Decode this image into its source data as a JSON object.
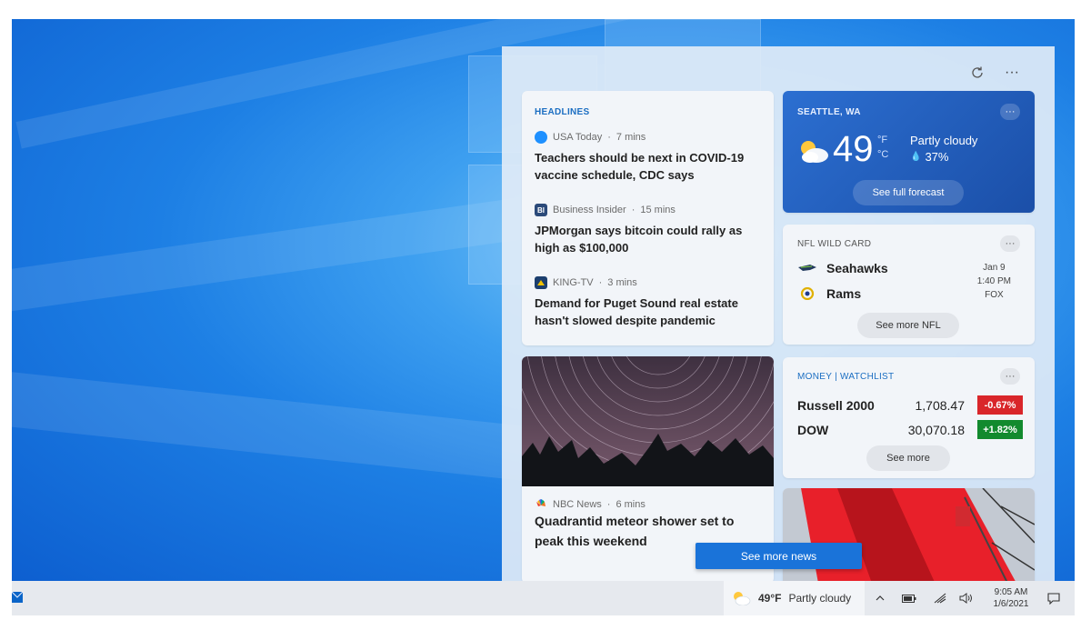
{
  "panel": {
    "refresh_icon": "refresh-icon",
    "more_icon": "more-icon",
    "see_more_news": "See more news"
  },
  "headlines": {
    "title": "HEADLINES",
    "items": [
      {
        "source": "USA Today",
        "time": "7 mins",
        "headline": "Teachers should be next in COVID-19 vaccine schedule, CDC says",
        "logo_color": "#1e90ff"
      },
      {
        "source": "Business Insider",
        "time": "15 mins",
        "headline": "JPMorgan says bitcoin could rally as high as $100,000",
        "logo_text": "BI",
        "logo_color": "#2b4a7a"
      },
      {
        "source": "KING-TV",
        "time": "3 mins",
        "headline": "Demand for Puget Sound real estate hasn't slowed despite pandemic",
        "logo_color": "#1c3f6e"
      }
    ]
  },
  "weather": {
    "location": "SEATTLE, WA",
    "temp": "49",
    "unit_f": "°F",
    "unit_c": "°C",
    "condition": "Partly cloudy",
    "precip": "37%",
    "forecast_btn": "See full forecast"
  },
  "nfl": {
    "title": "NFL WILD CARD",
    "team1": "Seahawks",
    "team2": "Rams",
    "date": "Jan 9",
    "time": "1:40 PM",
    "network": "FOX",
    "more_btn": "See more NFL"
  },
  "money": {
    "title": "MONEY | WATCHLIST",
    "stocks": [
      {
        "name": "Russell 2000",
        "value": "1,708.47",
        "change": "-0.67%",
        "color": "#d9262a"
      },
      {
        "name": "DOW",
        "value": "30,070.18",
        "change": "+1.82%",
        "color": "#128a2e"
      }
    ],
    "more_btn": "See more"
  },
  "photo_news": {
    "source": "NBC News",
    "time": "6 mins",
    "headline": "Quadrantid meteor shower set to peak this weekend"
  },
  "taskbar": {
    "weather_temp": "49°F",
    "weather_cond": "Partly cloudy",
    "time": "9:05 AM",
    "date": "1/6/2021"
  }
}
